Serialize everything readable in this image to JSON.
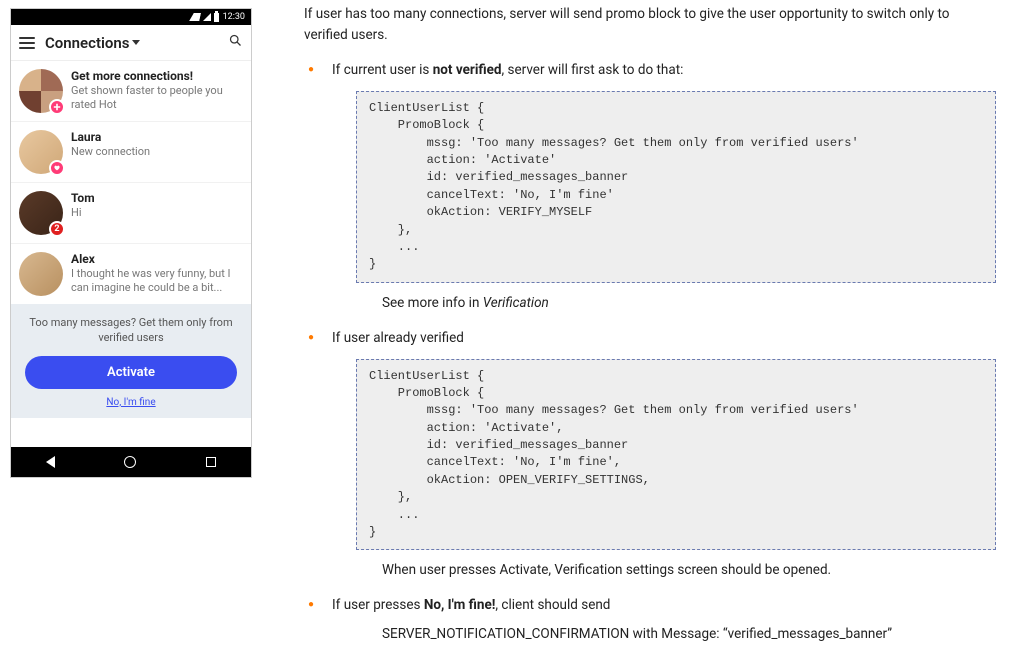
{
  "phone": {
    "status_time": "12:30",
    "appbar_title": "Connections",
    "items": [
      {
        "title": "Get more connections!",
        "sub": "Get shown faster to people you rated Hot"
      },
      {
        "title": "Laura",
        "sub": "New connection"
      },
      {
        "title": "Tom",
        "sub": "Hi",
        "badge_count": "2"
      },
      {
        "title": "Alex",
        "sub": "I thought he was very funny, but I can imagine he could be a bit..."
      }
    ],
    "promo_msg": "Too many messages? Get them only from verified users",
    "activate_label": "Activate",
    "fine_label": "No, I'm fine"
  },
  "doc": {
    "intro": "If user has too many connections, server will send promo block to give the user opportunity to switch only to verified users.",
    "bullet1_pre": "If current user is ",
    "bullet1_b": "not verified",
    "bullet1_post": ", server will first ask to do that:",
    "code1": "ClientUserList {\n    PromoBlock {\n        mssg: 'Too many messages? Get them only from verified users'\n        action: 'Activate'\n        id: verified_messages_banner\n        cancelText: 'No, I'm fine'\n        okAction: VERIFY_MYSELF\n    },\n    ...\n}",
    "after1_pre": "See more info in ",
    "after1_i": "Verification",
    "bullet2": "If user already verified",
    "code2": "ClientUserList {\n    PromoBlock {\n        mssg: 'Too many messages? Get them only from verified users'\n        action: 'Activate',\n        id: verified_messages_banner\n        cancelText: 'No, I'm fine',\n        okAction: OPEN_VERIFY_SETTINGS,\n    },\n    ...\n}",
    "after2": "When user presses Activate, Verification settings screen should be opened.",
    "bullet3_pre": "If user presses ",
    "bullet3_b": "No, I'm fine!",
    "bullet3_post": ", client should send",
    "confirm_pre": "SERVER_NOTIFICATION_CONFIRMATION with Message: ",
    "confirm_q": "“verified_messages_banner”"
  }
}
